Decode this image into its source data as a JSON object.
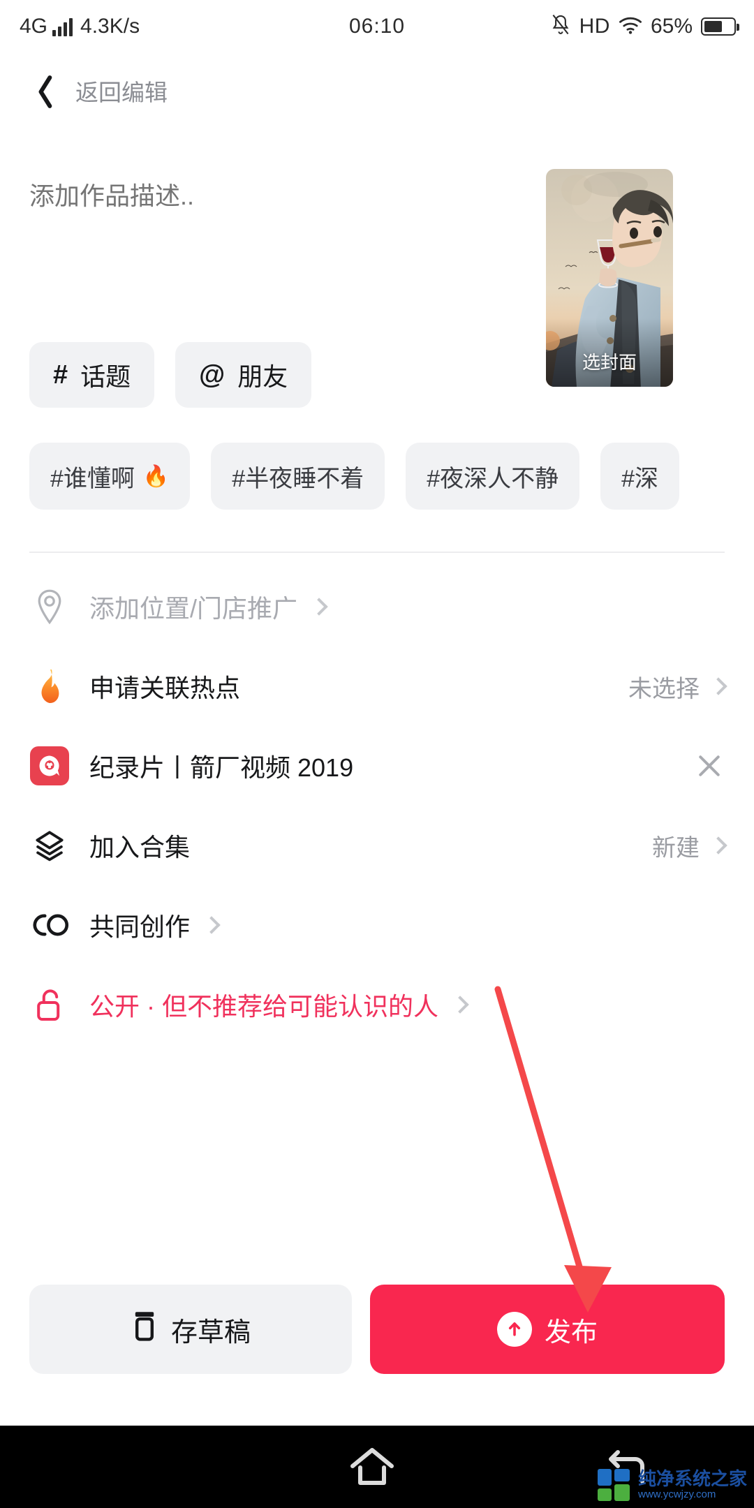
{
  "status_bar": {
    "network_type": "4G",
    "speed": "4.3K/s",
    "time": "06:10",
    "hd_label": "HD",
    "battery_percent": "65%",
    "icons": [
      "signal-bars-icon",
      "mute-bell-icon",
      "hd-icon",
      "wifi-icon",
      "battery-icon"
    ]
  },
  "header": {
    "back_label": "返回编辑"
  },
  "composer": {
    "description_placeholder": "添加作品描述..",
    "description_value": "",
    "cover": {
      "label": "选封面"
    }
  },
  "quick_actions": [
    {
      "symbol": "#",
      "label": "话题",
      "name": "topic"
    },
    {
      "symbol": "@",
      "label": "朋友",
      "name": "friend"
    }
  ],
  "suggested_tags": [
    {
      "text": "#谁懂啊",
      "fire": "🔥"
    },
    {
      "text": "#半夜睡不着",
      "fire": ""
    },
    {
      "text": "#夜深人不静",
      "fire": ""
    },
    {
      "text": "#深",
      "fire": ""
    }
  ],
  "options": [
    {
      "icon": "location-pin-icon",
      "label": "添加位置/门店推广",
      "value": "",
      "muted": true,
      "chevron": true,
      "close": false
    },
    {
      "icon": "flame-icon",
      "label": "申请关联热点",
      "value": "未选择",
      "muted": false,
      "chevron": true,
      "close": false
    },
    {
      "icon": "film-badge-icon",
      "label": "纪录片丨箭厂视频 2019",
      "value": "",
      "muted": false,
      "chevron": false,
      "close": true
    },
    {
      "icon": "layers-icon",
      "label": "加入合集",
      "value": "新建",
      "muted": false,
      "chevron": true,
      "close": false
    },
    {
      "icon": "co-create-icon",
      "label": "共同创作",
      "value": "",
      "muted": false,
      "chevron": true,
      "close": false
    },
    {
      "icon": "unlock-icon",
      "label": "公开 · 但不推荐给可能认识的人",
      "value": "",
      "muted": false,
      "chevron": true,
      "close": false,
      "danger": true
    }
  ],
  "footer": {
    "draft_label": "存草稿",
    "publish_label": "发布"
  },
  "nav_bar": {
    "items": [
      "menu-icon",
      "home-icon",
      "back-icon"
    ]
  },
  "watermark": {
    "name": "纯净系统之家",
    "url": "www.ycwjzy.com"
  },
  "colors": {
    "accent_red": "#f9274f",
    "danger_text": "#f0315c",
    "chip_bg": "#f1f2f4",
    "muted_text": "#8b8d93",
    "annotation_red": "#f4484a"
  }
}
